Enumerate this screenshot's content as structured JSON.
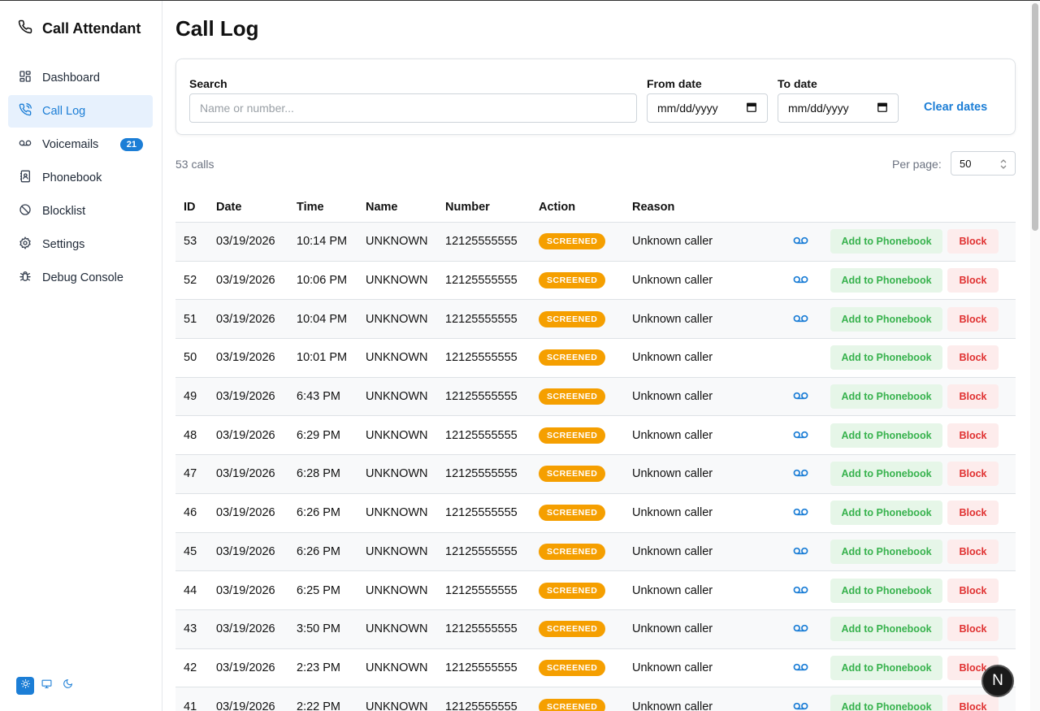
{
  "app": {
    "title": "Call Attendant"
  },
  "sidebar": {
    "items": [
      {
        "label": "Dashboard",
        "icon": "dashboard-icon"
      },
      {
        "label": "Call Log",
        "icon": "phone-call-icon",
        "active": true
      },
      {
        "label": "Voicemails",
        "icon": "voicemail-icon",
        "badge": "21"
      },
      {
        "label": "Phonebook",
        "icon": "address-book-icon"
      },
      {
        "label": "Blocklist",
        "icon": "ban-icon"
      },
      {
        "label": "Settings",
        "icon": "gear-icon"
      },
      {
        "label": "Debug Console",
        "icon": "bug-icon"
      }
    ],
    "theme_modes": [
      "light",
      "system",
      "dark"
    ],
    "theme_selected": "light"
  },
  "page": {
    "title": "Call Log"
  },
  "filters": {
    "search_label": "Search",
    "search_placeholder": "Name or number...",
    "from_label": "From date",
    "from_value": "mm/dd/yyyy",
    "to_label": "To date",
    "to_value": "mm/dd/yyyy",
    "clear_label": "Clear dates"
  },
  "summary": {
    "count_text": "53 calls",
    "per_page_label": "Per page:",
    "per_page_value": "50"
  },
  "table": {
    "columns": [
      "ID",
      "Date",
      "Time",
      "Name",
      "Number",
      "Action",
      "Reason"
    ],
    "add_label": "Add to Phonebook",
    "block_label": "Block",
    "rows": [
      {
        "id": "53",
        "date": "03/19/2026",
        "time": "10:14 PM",
        "name": "UNKNOWN",
        "number": "12125555555",
        "action": "SCREENED",
        "reason": "Unknown caller",
        "voicemail": true
      },
      {
        "id": "52",
        "date": "03/19/2026",
        "time": "10:06 PM",
        "name": "UNKNOWN",
        "number": "12125555555",
        "action": "SCREENED",
        "reason": "Unknown caller",
        "voicemail": true
      },
      {
        "id": "51",
        "date": "03/19/2026",
        "time": "10:04 PM",
        "name": "UNKNOWN",
        "number": "12125555555",
        "action": "SCREENED",
        "reason": "Unknown caller",
        "voicemail": true
      },
      {
        "id": "50",
        "date": "03/19/2026",
        "time": "10:01 PM",
        "name": "UNKNOWN",
        "number": "12125555555",
        "action": "SCREENED",
        "reason": "Unknown caller",
        "voicemail": false
      },
      {
        "id": "49",
        "date": "03/19/2026",
        "time": "6:43 PM",
        "name": "UNKNOWN",
        "number": "12125555555",
        "action": "SCREENED",
        "reason": "Unknown caller",
        "voicemail": true
      },
      {
        "id": "48",
        "date": "03/19/2026",
        "time": "6:29 PM",
        "name": "UNKNOWN",
        "number": "12125555555",
        "action": "SCREENED",
        "reason": "Unknown caller",
        "voicemail": true
      },
      {
        "id": "47",
        "date": "03/19/2026",
        "time": "6:28 PM",
        "name": "UNKNOWN",
        "number": "12125555555",
        "action": "SCREENED",
        "reason": "Unknown caller",
        "voicemail": true
      },
      {
        "id": "46",
        "date": "03/19/2026",
        "time": "6:26 PM",
        "name": "UNKNOWN",
        "number": "12125555555",
        "action": "SCREENED",
        "reason": "Unknown caller",
        "voicemail": true
      },
      {
        "id": "45",
        "date": "03/19/2026",
        "time": "6:26 PM",
        "name": "UNKNOWN",
        "number": "12125555555",
        "action": "SCREENED",
        "reason": "Unknown caller",
        "voicemail": true
      },
      {
        "id": "44",
        "date": "03/19/2026",
        "time": "6:25 PM",
        "name": "UNKNOWN",
        "number": "12125555555",
        "action": "SCREENED",
        "reason": "Unknown caller",
        "voicemail": true
      },
      {
        "id": "43",
        "date": "03/19/2026",
        "time": "3:50 PM",
        "name": "UNKNOWN",
        "number": "12125555555",
        "action": "SCREENED",
        "reason": "Unknown caller",
        "voicemail": true
      },
      {
        "id": "42",
        "date": "03/19/2026",
        "time": "2:23 PM",
        "name": "UNKNOWN",
        "number": "12125555555",
        "action": "SCREENED",
        "reason": "Unknown caller",
        "voicemail": true
      },
      {
        "id": "41",
        "date": "03/19/2026",
        "time": "2:22 PM",
        "name": "UNKNOWN",
        "number": "12125555555",
        "action": "SCREENED",
        "reason": "Unknown caller",
        "voicemail": true
      }
    ]
  },
  "overlay": {
    "avatar_letter": "N"
  },
  "colors": {
    "accent": "#1c7ed6",
    "screened": "#f59f00",
    "add_text": "#37b24d",
    "block_text": "#e03131"
  }
}
